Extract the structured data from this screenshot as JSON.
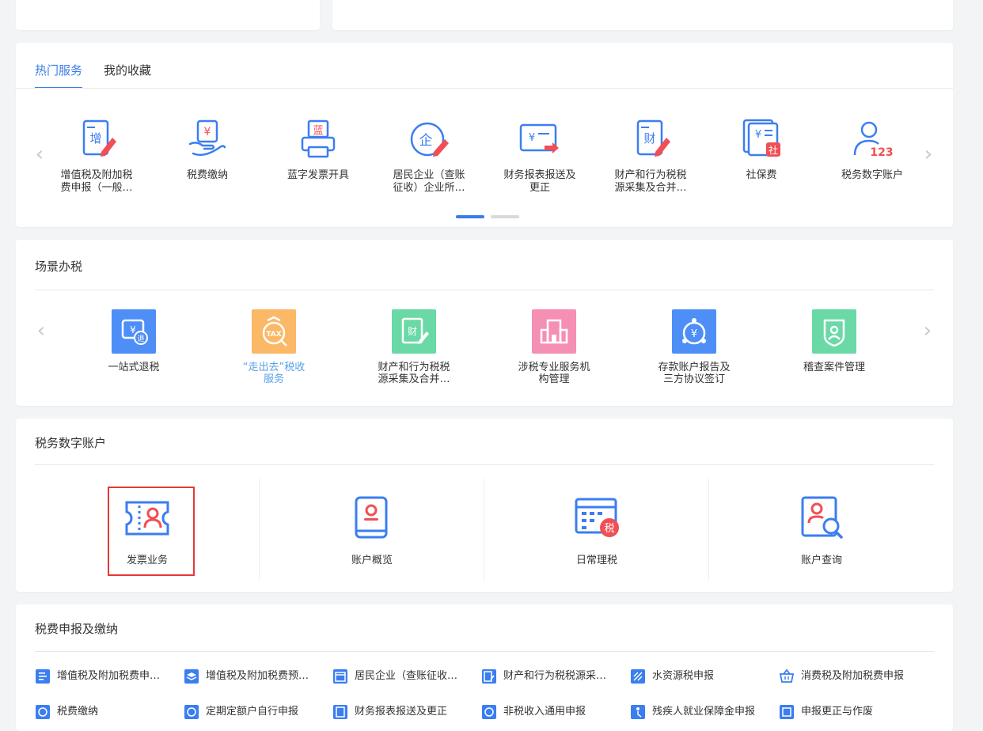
{
  "hot_services": {
    "tabs": [
      {
        "label": "热门服务",
        "active": true
      },
      {
        "label": "我的收藏",
        "active": false
      }
    ],
    "items": [
      {
        "icon": "vat-declare-icon",
        "line1": "增值税及附加税",
        "line2": "费申报（一般…"
      },
      {
        "icon": "tax-payment-icon",
        "line1": "税费缴纳",
        "line2": ""
      },
      {
        "icon": "blue-invoice-icon",
        "line1": "蓝字发票开具",
        "line2": ""
      },
      {
        "icon": "resident-enterprise-icon",
        "line1": "居民企业（查账",
        "line2": "征收）企业所…"
      },
      {
        "icon": "financial-report-icon",
        "line1": "财务报表报送及",
        "line2": "更正"
      },
      {
        "icon": "property-behavior-tax-icon",
        "line1": "财产和行为税税",
        "line2": "源采集及合并…"
      },
      {
        "icon": "social-insurance-icon",
        "line1": "社保费",
        "line2": ""
      },
      {
        "icon": "digital-account-icon",
        "line1": "税务数字账户",
        "line2": ""
      }
    ],
    "page_count": 2,
    "current_page": 1
  },
  "scene_tax": {
    "title": "场景办税",
    "items": [
      {
        "icon": "refund-icon",
        "color": "#4d8ef7",
        "line1": "一站式退税",
        "line2": "",
        "link": false
      },
      {
        "icon": "go-global-tax-icon",
        "color": "#fbb866",
        "line1": "“走出去”税收",
        "line2": "服务",
        "link": true
      },
      {
        "icon": "property-tax-collect-icon",
        "color": "#6ad9a6",
        "line1": "财产和行为税税",
        "line2": "源采集及合并…",
        "link": false
      },
      {
        "icon": "agency-building-icon",
        "color": "#f58fb4",
        "line1": "涉税专业服务机",
        "line2": "构管理",
        "link": false
      },
      {
        "icon": "deposit-account-icon",
        "color": "#4d8ef7",
        "line1": "存款账户报告及",
        "line2": "三方协议签订",
        "link": false
      },
      {
        "icon": "inspection-case-icon",
        "color": "#6ad9a6",
        "line1": "稽查案件管理",
        "line2": "",
        "link": false
      }
    ]
  },
  "digital_account": {
    "title": "税务数字账户",
    "items": [
      {
        "icon": "invoice-business-icon",
        "label": "发票业务",
        "selected": true
      },
      {
        "icon": "account-overview-icon",
        "label": "账户概览",
        "selected": false
      },
      {
        "icon": "daily-tax-icon",
        "label": "日常理税",
        "selected": false
      },
      {
        "icon": "account-query-icon",
        "label": "账户查询",
        "selected": false
      }
    ]
  },
  "tax_declare": {
    "title": "税费申报及缴纳",
    "rows": [
      [
        {
          "icon": "vat-form-icon",
          "label": "增值税及附加税费申…"
        },
        {
          "icon": "layers-icon",
          "label": "增值税及附加税费预…"
        },
        {
          "icon": "calendar-icon",
          "label": "居民企业（查账征收…"
        },
        {
          "icon": "doc-edit-icon",
          "label": "财产和行为税税源采…"
        },
        {
          "icon": "water-resource-icon",
          "label": "水资源税申报"
        },
        {
          "icon": "basket-icon",
          "label": "消费税及附加税费申报"
        }
      ],
      [
        {
          "icon": "tax-pay-icon",
          "label": "税费缴纳"
        },
        {
          "icon": "fixed-quota-icon",
          "label": "定期定额户自行申报"
        },
        {
          "icon": "report-icon",
          "label": "财务报表报送及更正"
        },
        {
          "icon": "non-tax-icon",
          "label": "非税收入通用申报"
        },
        {
          "icon": "disabled-employment-icon",
          "label": "残疾人就业保障金申报"
        },
        {
          "icon": "correction-icon",
          "label": "申报更正与作废"
        }
      ]
    ]
  },
  "colors": {
    "primary": "#3a7ce6",
    "icon_blue": "#3b7ef0",
    "icon_red": "#f04f55",
    "highlight_border": "#e53935",
    "page_bg": "#f3f4f6"
  }
}
